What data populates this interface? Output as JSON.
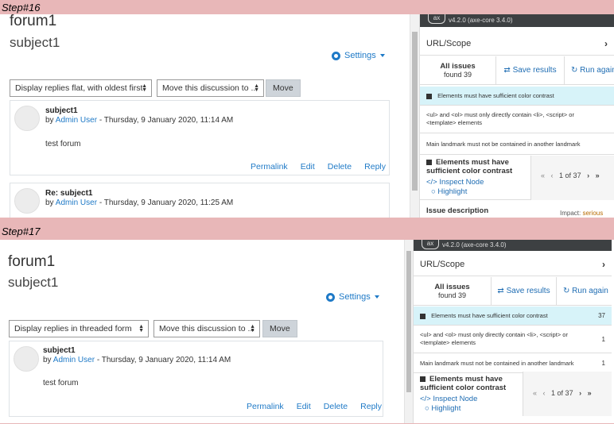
{
  "steps": [
    {
      "label": "Step#16",
      "forum_title": "forum1",
      "subject_title": "subject1",
      "settings_label": "Settings",
      "display_select": "Display replies flat, with oldest first",
      "move_select": "Move this discussion to ...",
      "move_button": "Move",
      "posts": [
        {
          "subject": "subject1",
          "by": "by",
          "user": "Admin User",
          "date": "- Thursday, 9 January 2020, 11:14 AM",
          "body": "test forum",
          "actions": [
            "Permalink",
            "Edit",
            "Delete",
            "Reply"
          ]
        },
        {
          "subject": "Re: subject1",
          "by": "by",
          "user": "Admin User",
          "date": "- Thursday, 9 January 2020, 11:25 AM"
        }
      ],
      "axe": {
        "version": "v4.2.0",
        "core": "(axe-core 3.4.0)",
        "url_scope": "URL/Scope",
        "all_issues": "All issues",
        "found": "found 39",
        "save_results": "Save results",
        "run_again": "Run again",
        "issues": [
          {
            "text": "Elements must have sufficient color contrast"
          },
          {
            "text": "<ul> and <ol> must only directly contain <li>, <script> or <template> elements"
          },
          {
            "text": "Main landmark must not be contained in another landmark"
          }
        ],
        "detail_title": "Elements must have sufficient color contrast",
        "inspect_node": "Inspect Node",
        "highlight": "Highlight",
        "pager": "1 of 37",
        "issue_description": "Issue description",
        "impact_label": "Impact:",
        "impact_value": "serious"
      }
    },
    {
      "label": "Step#17",
      "forum_title": "forum1",
      "subject_title": "subject1",
      "settings_label": "Settings",
      "display_select": "Display replies in threaded form",
      "move_select": "Move this discussion to ...",
      "move_button": "Move",
      "posts": [
        {
          "subject": "subject1",
          "by": "by",
          "user": "Admin User",
          "date": "- Thursday, 9 January 2020, 11:14 AM",
          "body": "test forum",
          "actions": [
            "Permalink",
            "Edit",
            "Delete",
            "Reply"
          ]
        }
      ],
      "axe": {
        "version": "v4.2.0",
        "core": "(axe-core 3.4.0)",
        "url_scope": "URL/Scope",
        "all_issues": "All issues",
        "found": "found 39",
        "save_results": "Save results",
        "run_again": "Run again",
        "issues": [
          {
            "text": "Elements must have sufficient color contrast",
            "count": "37"
          },
          {
            "text": "<ul> and <ol> must only directly contain <li>, <script> or <template> elements",
            "count": "1"
          },
          {
            "text": "Main landmark must not be contained in another landmark",
            "count": "1"
          }
        ],
        "detail_title": "Elements must have sufficient color contrast",
        "inspect_node": "Inspect Node",
        "highlight": "Highlight",
        "pager": "1 of 37"
      }
    }
  ]
}
